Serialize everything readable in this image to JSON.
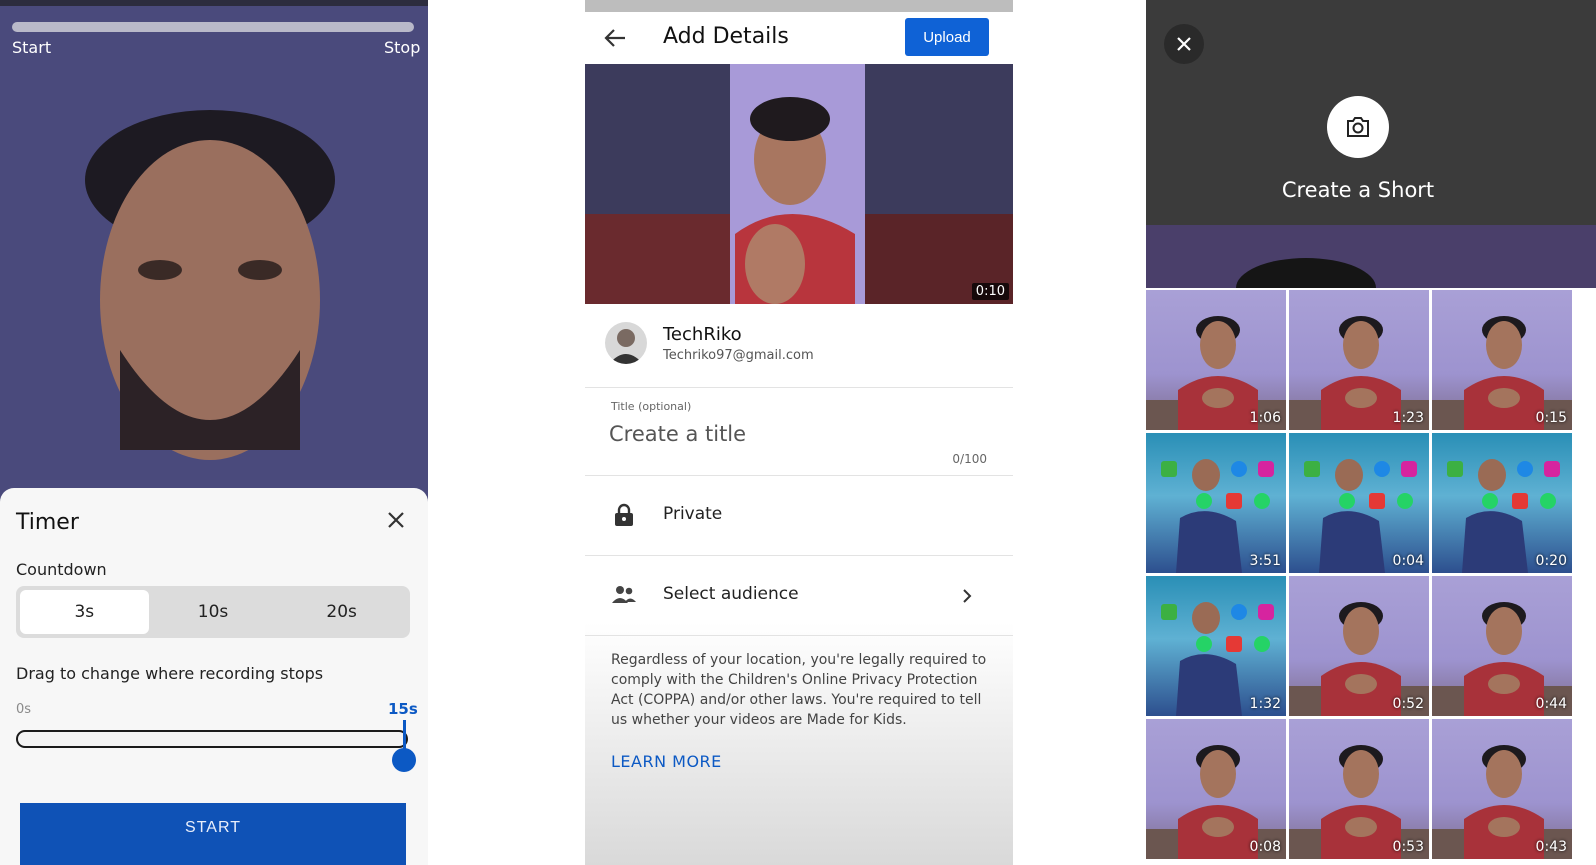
{
  "recorder": {
    "start_label": "Start",
    "stop_label": "Stop",
    "timer_sheet": {
      "title": "Timer",
      "countdown_label": "Countdown",
      "options": [
        "3s",
        "10s",
        "20s"
      ],
      "selected_option": "3s",
      "drag_label": "Drag to change where recording stops",
      "range_min": "0s",
      "range_max": "15s",
      "stop_fraction": 1.0,
      "start_button": "START"
    }
  },
  "details": {
    "title": "Add Details",
    "upload_button": "Upload",
    "preview_duration": "0:10",
    "account": {
      "name": "TechRiko",
      "email": "Techriko97@gmail.com"
    },
    "title_caption": "Title (optional)",
    "title_placeholder": "Create a title",
    "title_counter": "0/100",
    "visibility": "Private",
    "audience": "Select audience",
    "legal_text": "Regardless of your location, you're legally required to comply with the Children's Online Privacy Protection Act (COPPA) and/or other laws. You're required to tell us whether your videos are Made for Kids.",
    "learn_more": "LEARN MORE"
  },
  "gallery": {
    "create_label": "Create a Short",
    "items": [
      {
        "duration": "1:06",
        "kind": "purple"
      },
      {
        "duration": "1:23",
        "kind": "purple"
      },
      {
        "duration": "0:15",
        "kind": "purple"
      },
      {
        "duration": "3:51",
        "kind": "teal"
      },
      {
        "duration": "0:04",
        "kind": "teal"
      },
      {
        "duration": "0:20",
        "kind": "teal"
      },
      {
        "duration": "1:32",
        "kind": "teal"
      },
      {
        "duration": "0:52",
        "kind": "purple"
      },
      {
        "duration": "0:44",
        "kind": "purple"
      },
      {
        "duration": "0:08",
        "kind": "purple"
      },
      {
        "duration": "0:53",
        "kind": "purple"
      },
      {
        "duration": "0:43",
        "kind": "purple"
      }
    ]
  },
  "colors": {
    "accent": "#0f52b6",
    "link": "#0c59c4",
    "upload": "#0f62d6"
  }
}
